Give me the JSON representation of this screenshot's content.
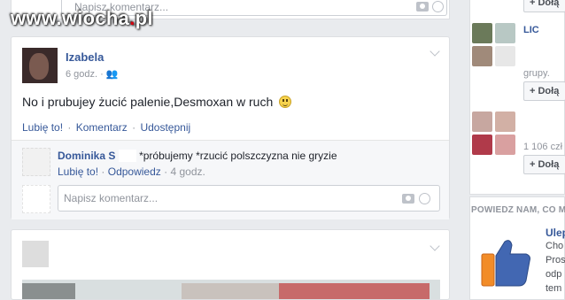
{
  "top_comment": {
    "placeholder": "Napisz komentarz..."
  },
  "watermark": {
    "text_a": "www.wiocha",
    "dot": ".",
    "text_b": "pl"
  },
  "post": {
    "author": "Izabela",
    "time": "6 godz. ·",
    "text": "No i prubujey żucić palenie,Desmoxan w ruch",
    "emoji_icon": "smile-emoji-icon",
    "actions": {
      "like": "Lubię to!",
      "comment": "Komentarz",
      "share": "Udostępnij",
      "sep": "·"
    },
    "comment": {
      "author": "Dominika S",
      "text": "*próbujemy *rzucić polszczyzna nie gryzie",
      "like": "Lubię to!",
      "reply": "Odpowiedz",
      "time": "4 godz.",
      "sep": "·"
    },
    "write_placeholder": "Napisz komentarz..."
  },
  "right": {
    "group_a": {
      "name": "LIC",
      "sub": "grupy.",
      "button": "+ Dołą"
    },
    "group_b": {
      "sub": "1 106 czł",
      "button": "+ Dołą"
    },
    "top_button": "+ Dołą",
    "section_title": "POWIEDZ NAM, CO M",
    "promo": {
      "heading": "Ulep",
      "lines": [
        "Cho",
        "Pros",
        "odp",
        "tem"
      ]
    },
    "like_icon": "thumbs-up-icon",
    "brand_color": "#4267b2"
  },
  "colors": {
    "link": "#365899",
    "bg": "#e9ebee",
    "watermark_red": "#d6000d"
  }
}
